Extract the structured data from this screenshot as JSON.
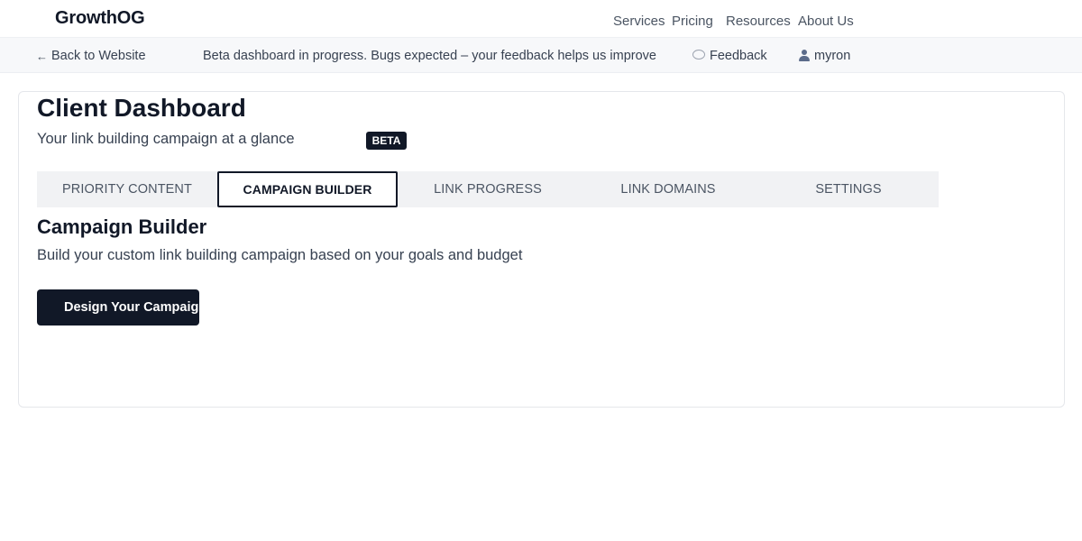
{
  "header": {
    "brand": "GrowthOG",
    "nav": {
      "services": "Services",
      "pricing": "Pricing",
      "resources": "Resources",
      "about": "About Us"
    }
  },
  "beta_bar": {
    "back_label": "Back to Website",
    "message": "Beta dashboard in progress. Bugs expected – your feedback helps us improve",
    "feedback_label": "Feedback",
    "username": "myron"
  },
  "dashboard": {
    "title": "Client Dashboard",
    "subtitle": "Your link building campaign at a glance",
    "badge": "BETA",
    "tabs": [
      {
        "label": "PRIORITY CONTENT",
        "active": false
      },
      {
        "label": "CAMPAIGN BUILDER",
        "active": true
      },
      {
        "label": "LINK PROGRESS",
        "active": false
      },
      {
        "label": "LINK DOMAINS",
        "active": false
      },
      {
        "label": "SETTINGS",
        "active": false
      }
    ],
    "section": {
      "title": "Campaign Builder",
      "description": "Build your custom link building campaign based on your goals and budget",
      "button_label": "Design Your Campaign"
    }
  },
  "colors": {
    "primary_dark": "#111827",
    "beta_bar_bg": "#f7f8fa",
    "tab_bg": "#f1f2f4"
  }
}
